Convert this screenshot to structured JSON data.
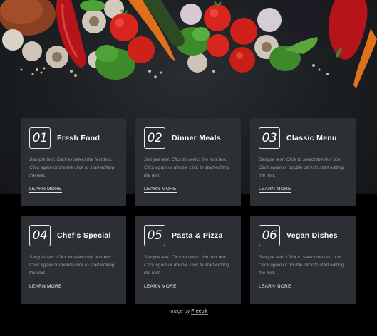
{
  "hero": {
    "image_alt_icon": "vegetables-photo-icon"
  },
  "cards": [
    {
      "number": "01",
      "title": "Fresh Food",
      "text": "Sample text. Click to select the text box. Click again or double click to start editing the text.",
      "link": "LEARN MORE"
    },
    {
      "number": "02",
      "title": "Dinner Meals",
      "text": "Sample text. Click to select the text box. Click again or double click to start editing the text.",
      "link": "LEARN MORE"
    },
    {
      "number": "03",
      "title": "Classic Menu",
      "text": "Sample text. Click to select the text box. Click again or double click to start editing the text.",
      "link": "LEARN MORE"
    },
    {
      "number": "04",
      "title": "Chef’s Special",
      "text": "Sample text. Click to select the text box. Click again or double click to start editing the text.",
      "link": "LEARN MORE"
    },
    {
      "number": "05",
      "title": "Pasta & Pizza",
      "text": "Sample text. Click to select the text box. Click again or double click to start editing the text.",
      "link": "LEARN MORE"
    },
    {
      "number": "06",
      "title": "Vegan Dishes",
      "text": "Sample text. Click to select the text box. Click again or double click to start editing the text.",
      "link": "LEARN MORE"
    }
  ],
  "credit": {
    "prefix": "Image by",
    "link": "Freepik"
  },
  "colors": {
    "background": "#000000",
    "card": "#2c2f33",
    "tomato": "#d8261e",
    "pepper": "#b4141a",
    "herb": "#3e8a2a",
    "carrot": "#e0701c"
  }
}
